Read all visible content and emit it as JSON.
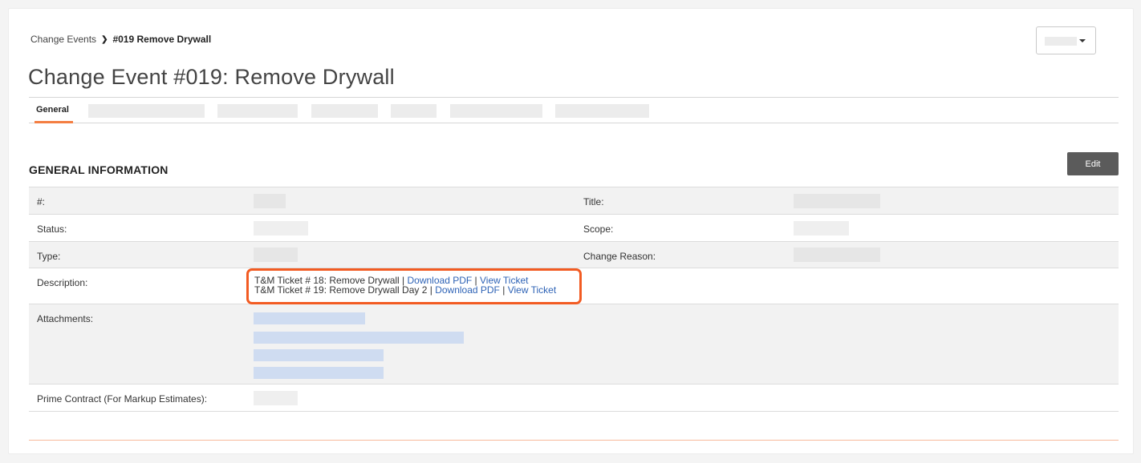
{
  "breadcrumb": {
    "parent": "Change Events",
    "separator": "❯",
    "current": "#019 Remove Drywall"
  },
  "page": {
    "title": "Change Event #019: Remove Drywall"
  },
  "tabs": {
    "active": "General"
  },
  "section": {
    "title": "GENERAL INFORMATION",
    "edit_label": "Edit"
  },
  "fields": {
    "number_label": "#:",
    "title_label": "Title:",
    "status_label": "Status:",
    "scope_label": "Scope:",
    "type_label": "Type:",
    "change_reason_label": "Change Reason:",
    "description_label": "Description:",
    "attachments_label": "Attachments:",
    "prime_contract_label": "Prime Contract (For Markup Estimates):"
  },
  "description": {
    "line1_text": "T&M Ticket # 18: Remove Drywall | ",
    "line1_download": "Download PDF",
    "line1_sep": " | ",
    "line1_view": "View Ticket",
    "line2_text": "T&M Ticket # 19: Remove Drywall Day 2 | ",
    "line2_download": "Download PDF",
    "line2_sep": " | ",
    "line2_view": "View Ticket"
  },
  "colors": {
    "accent": "#f47e42",
    "highlight": "#f25b22",
    "link": "#2e63b6",
    "button": "#5b5b5b"
  }
}
